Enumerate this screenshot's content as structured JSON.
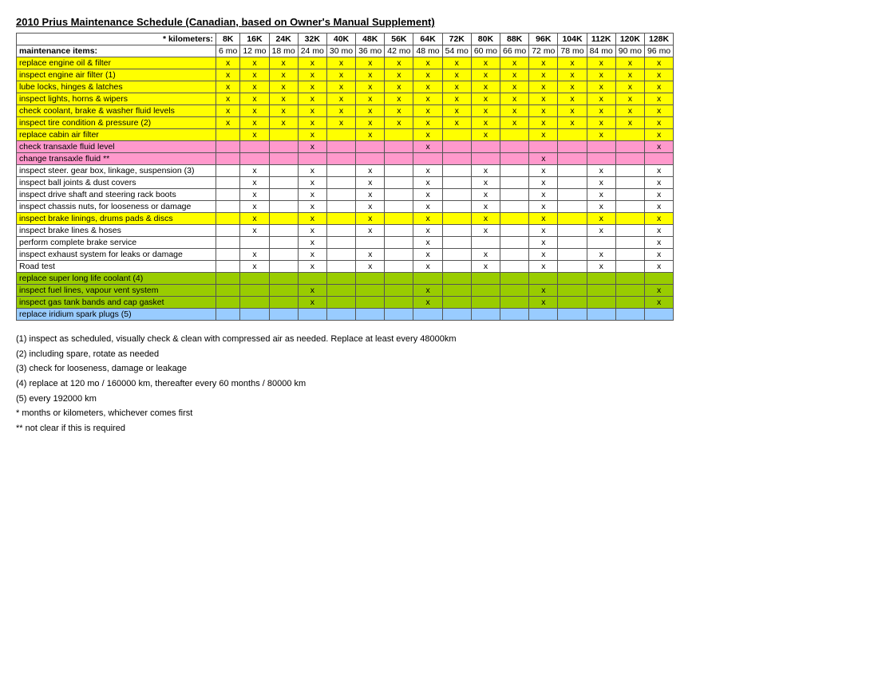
{
  "title": "2010 Prius Maintenance Schedule (Canadian, based on Owner's Manual Supplement)",
  "km_header": "* kilometers:",
  "km_values": [
    "8K",
    "16K",
    "24K",
    "32K",
    "40K",
    "48K",
    "56K",
    "64K",
    "72K",
    "80K",
    "88K",
    "96K",
    "104K",
    "112K",
    "120K",
    "128K"
  ],
  "month_label": "maintenance items:",
  "month_values": [
    "6 mo",
    "12 mo",
    "18 mo",
    "24 mo",
    "30 mo",
    "36 mo",
    "42 mo",
    "48 mo",
    "54 mo",
    "60 mo",
    "66 mo",
    "72 mo",
    "78 mo",
    "84 mo",
    "90 mo",
    "96 mo"
  ],
  "rows": [
    {
      "label": "replace engine oil & filter",
      "color": "yellow",
      "cells": [
        "x",
        "x",
        "x",
        "x",
        "x",
        "x",
        "x",
        "x",
        "x",
        "x",
        "x",
        "x",
        "x",
        "x",
        "x",
        "x"
      ]
    },
    {
      "label": "inspect engine air filter (1)",
      "color": "yellow",
      "cells": [
        "x",
        "x",
        "x",
        "x",
        "x",
        "x",
        "x",
        "x",
        "x",
        "x",
        "x",
        "x",
        "x",
        "x",
        "x",
        "x"
      ]
    },
    {
      "label": "lube locks, hinges & latches",
      "color": "yellow",
      "cells": [
        "x",
        "x",
        "x",
        "x",
        "x",
        "x",
        "x",
        "x",
        "x",
        "x",
        "x",
        "x",
        "x",
        "x",
        "x",
        "x"
      ]
    },
    {
      "label": "inspect lights, horns & wipers",
      "color": "yellow",
      "cells": [
        "x",
        "x",
        "x",
        "x",
        "x",
        "x",
        "x",
        "x",
        "x",
        "x",
        "x",
        "x",
        "x",
        "x",
        "x",
        "x"
      ]
    },
    {
      "label": "check coolant, brake & washer fluid levels",
      "color": "yellow",
      "cells": [
        "x",
        "x",
        "x",
        "x",
        "x",
        "x",
        "x",
        "x",
        "x",
        "x",
        "x",
        "x",
        "x",
        "x",
        "x",
        "x"
      ]
    },
    {
      "label": "inspect tire condition & pressure (2)",
      "color": "yellow",
      "cells": [
        "x",
        "x",
        "x",
        "x",
        "x",
        "x",
        "x",
        "x",
        "x",
        "x",
        "x",
        "x",
        "x",
        "x",
        "x",
        "x"
      ]
    },
    {
      "label": "replace cabin air filter",
      "color": "yellow",
      "cells": [
        "",
        "x",
        "",
        "x",
        "",
        "x",
        "",
        "x",
        "",
        "x",
        "",
        "x",
        "",
        "x",
        "",
        "x"
      ]
    },
    {
      "label": "check transaxle fluid level",
      "color": "pink",
      "cells": [
        "",
        "",
        "",
        "x",
        "",
        "",
        "",
        "x",
        "",
        "",
        "",
        "",
        "",
        "",
        "",
        "x"
      ]
    },
    {
      "label": "change transaxle fluid **",
      "color": "pink",
      "cells": [
        "",
        "",
        "",
        "",
        "",
        "",
        "",
        "",
        "",
        "",
        "",
        "x",
        "",
        "",
        "",
        ""
      ]
    },
    {
      "label": "inspect steer. gear box, linkage, suspension (3)",
      "color": "white",
      "cells": [
        "",
        "x",
        "",
        "x",
        "",
        "x",
        "",
        "x",
        "",
        "x",
        "",
        "x",
        "",
        "x",
        "",
        "x"
      ]
    },
    {
      "label": "inspect ball joints & dust covers",
      "color": "white",
      "cells": [
        "",
        "x",
        "",
        "x",
        "",
        "x",
        "",
        "x",
        "",
        "x",
        "",
        "x",
        "",
        "x",
        "",
        "x"
      ]
    },
    {
      "label": "inspect drive shaft and steering rack boots",
      "color": "white",
      "cells": [
        "",
        "x",
        "",
        "x",
        "",
        "x",
        "",
        "x",
        "",
        "x",
        "",
        "x",
        "",
        "x",
        "",
        "x"
      ]
    },
    {
      "label": "inspect chassis nuts, for looseness or damage",
      "color": "white",
      "cells": [
        "",
        "x",
        "",
        "x",
        "",
        "x",
        "",
        "x",
        "",
        "x",
        "",
        "x",
        "",
        "x",
        "",
        "x"
      ]
    },
    {
      "label": "inspect brake linings, drums pads & discs",
      "color": "yellow",
      "cells": [
        "",
        "x",
        "",
        "x",
        "",
        "x",
        "",
        "x",
        "",
        "x",
        "",
        "x",
        "",
        "x",
        "",
        "x"
      ]
    },
    {
      "label": "inspect brake lines & hoses",
      "color": "white",
      "cells": [
        "",
        "x",
        "",
        "x",
        "",
        "x",
        "",
        "x",
        "",
        "x",
        "",
        "x",
        "",
        "x",
        "",
        "x"
      ]
    },
    {
      "label": "perform complete brake service",
      "color": "white",
      "cells": [
        "",
        "",
        "",
        "x",
        "",
        "",
        "",
        "x",
        "",
        "",
        "",
        "x",
        "",
        "",
        "",
        "x"
      ]
    },
    {
      "label": "inspect exhaust system for leaks or damage",
      "color": "white",
      "cells": [
        "",
        "x",
        "",
        "x",
        "",
        "x",
        "",
        "x",
        "",
        "x",
        "",
        "x",
        "",
        "x",
        "",
        "x"
      ]
    },
    {
      "label": "Road test",
      "color": "white",
      "cells": [
        "",
        "x",
        "",
        "x",
        "",
        "x",
        "",
        "x",
        "",
        "x",
        "",
        "x",
        "",
        "x",
        "",
        "x"
      ]
    },
    {
      "label": "replace super long life coolant (4)",
      "color": "green",
      "cells": [
        "",
        "",
        "",
        "",
        "",
        "",
        "",
        "",
        "",
        "",
        "",
        "",
        "",
        "",
        "",
        ""
      ]
    },
    {
      "label": "inspect fuel lines, vapour vent system",
      "color": "green",
      "cells": [
        "",
        "",
        "",
        "x",
        "",
        "",
        "",
        "x",
        "",
        "",
        "",
        "x",
        "",
        "",
        "",
        "x"
      ]
    },
    {
      "label": "inspect gas tank bands and cap gasket",
      "color": "green",
      "cells": [
        "",
        "",
        "",
        "x",
        "",
        "",
        "",
        "x",
        "",
        "",
        "",
        "x",
        "",
        "",
        "",
        "x"
      ]
    },
    {
      "label": "replace iridium spark plugs (5)",
      "color": "blue",
      "cells": [
        "",
        "",
        "",
        "",
        "",
        "",
        "",
        "",
        "",
        "",
        "",
        "",
        "",
        "",
        "",
        ""
      ]
    }
  ],
  "notes": [
    "(1) inspect as scheduled, visually check & clean with compressed air as needed. Replace at least every 48000km",
    "(2) including spare, rotate as needed",
    "(3) check for looseness, damage or leakage",
    "(4) replace at 120 mo / 160000 km, thereafter every 60 months / 80000 km",
    "(5) every 192000 km",
    "",
    "* months or kilometers, whichever comes first",
    "** not clear if this is required"
  ]
}
